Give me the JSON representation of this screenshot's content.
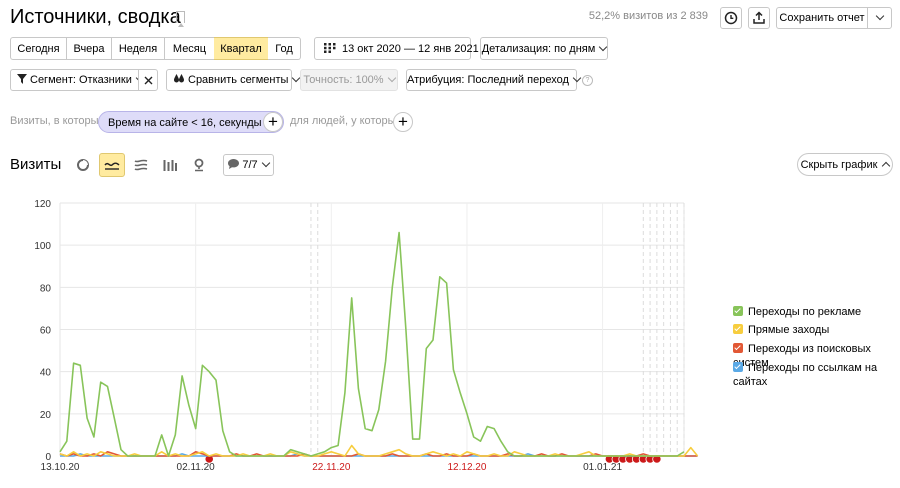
{
  "header": {
    "title": "Источники, сводка",
    "visits_info": "52,2% визитов из 2 839",
    "save_report": "Сохранить отчет"
  },
  "periods": [
    "Сегодня",
    "Вчера",
    "Неделя",
    "Месяц",
    "Квартал",
    "Год"
  ],
  "active_period": "Квартал",
  "date_range": "13 окт 2020 — 12 янв 2021",
  "detail": "Детализация: по дням",
  "toolbar": {
    "segment": "Сегмент: Отказники",
    "compare": "Сравнить сегменты",
    "accuracy": "Точность: 100%",
    "attribution": "Атрибуция: Последний переход"
  },
  "filters": {
    "visits_label": "Визиты, в которых",
    "pill": "Время на сайте < 16, секунды",
    "people_label": "для людей, у которых"
  },
  "chart_header": {
    "title": "Визиты",
    "series_count": "7/7",
    "hide_chart": "Скрыть график"
  },
  "colors": {
    "green": "#88c45a",
    "yellow": "#f7cd3e",
    "red": "#e25835",
    "blue": "#5aa9e6",
    "holiday": "#cc1a1a"
  },
  "chart_data": {
    "type": "line",
    "x_tick_labels": [
      "13.10.20",
      "02.11.20",
      "22.11.20",
      "12.12.20",
      "01.01.21"
    ],
    "holiday_tick_labels": [
      "22.11.20",
      "12.12.20"
    ],
    "ylim": [
      0,
      120
    ],
    "y_ticks": [
      0,
      20,
      40,
      60,
      80,
      100,
      120
    ],
    "legend_position": "right",
    "series": [
      {
        "name": "Переходы по рекламе",
        "color": "green",
        "values": [
          2,
          7,
          44,
          43,
          18,
          9,
          35,
          33,
          18,
          3,
          0,
          0,
          0,
          0,
          0,
          10,
          0,
          10,
          38,
          24,
          13,
          43,
          40,
          36,
          12,
          2,
          0,
          0,
          0,
          0,
          0,
          0,
          0,
          0,
          3,
          2,
          1,
          0,
          1,
          2,
          4,
          5,
          30,
          75,
          32,
          13,
          12,
          22,
          45,
          80,
          106,
          60,
          8,
          8,
          51,
          55,
          85,
          82,
          41,
          30,
          20,
          9,
          7,
          14,
          13,
          7,
          2,
          0,
          0,
          0,
          0,
          0,
          0,
          0,
          0,
          0,
          0,
          0,
          0,
          0,
          0,
          0,
          0,
          0,
          0,
          0,
          0,
          0,
          0,
          0,
          0,
          0,
          2
        ]
      },
      {
        "name": "Прямые заходы",
        "color": "yellow",
        "values": [
          1,
          0,
          2,
          0,
          1,
          0,
          2,
          1,
          0,
          0,
          0,
          1,
          0,
          0,
          0,
          2,
          0,
          1,
          0,
          0,
          1,
          2,
          0,
          1,
          0,
          0,
          0,
          1,
          0,
          0,
          0,
          1,
          0,
          0,
          2,
          1,
          0,
          0,
          0,
          1,
          2,
          1,
          0,
          5,
          1,
          0,
          0,
          0,
          1,
          2,
          3,
          1,
          0,
          0,
          1,
          2,
          1,
          0,
          1,
          0,
          2,
          1,
          0,
          0,
          1,
          0,
          0,
          2,
          1,
          0,
          0,
          0,
          0,
          1,
          0,
          0,
          0,
          1,
          2,
          0,
          0,
          0,
          0,
          0,
          1,
          0,
          0,
          0,
          0,
          0,
          0,
          0,
          0,
          4,
          0
        ]
      },
      {
        "name": "Переходы из поисковых систем",
        "color": "red",
        "values": [
          1,
          0,
          1,
          0,
          0,
          1,
          0,
          2,
          1,
          0,
          0,
          0,
          0,
          0,
          0,
          0,
          0,
          0,
          0,
          0,
          2,
          1,
          0,
          0,
          0,
          0,
          1,
          0,
          0,
          1,
          0,
          0,
          0,
          0,
          0,
          0,
          1,
          0,
          0,
          0,
          0,
          0,
          0,
          0,
          1,
          0,
          0,
          0,
          0,
          1,
          0,
          0,
          0,
          0,
          1,
          0,
          0,
          1,
          0,
          0,
          0,
          1,
          0,
          0,
          0,
          0,
          1,
          0,
          0,
          0,
          0,
          1,
          0,
          0,
          1,
          0,
          0,
          0,
          0,
          1,
          0,
          0,
          0,
          0,
          0,
          0,
          1,
          0,
          0,
          0,
          0,
          0,
          0,
          0,
          0
        ]
      },
      {
        "name": "Переходы по ссылкам на сайтах",
        "color": "blue",
        "values": [
          0,
          0,
          0,
          1,
          0,
          0,
          0,
          0,
          0,
          0,
          0,
          0,
          0,
          0,
          0,
          0,
          0,
          0,
          1,
          0,
          0,
          0,
          0,
          0,
          0,
          0,
          0,
          0,
          0,
          0,
          0,
          0,
          0,
          0,
          0,
          1,
          0,
          0,
          0,
          0,
          0,
          0,
          0,
          0,
          0,
          0,
          0,
          0,
          0,
          0,
          0,
          0,
          0,
          0,
          0,
          0,
          0,
          0,
          0,
          0,
          0,
          0,
          0,
          0,
          0,
          0,
          0,
          0,
          0,
          1,
          0,
          0,
          0,
          0,
          0,
          0,
          0,
          0,
          0,
          0,
          0,
          0,
          0,
          0,
          0,
          0,
          0,
          0,
          0,
          0,
          0,
          0,
          0,
          0,
          0
        ]
      }
    ]
  }
}
